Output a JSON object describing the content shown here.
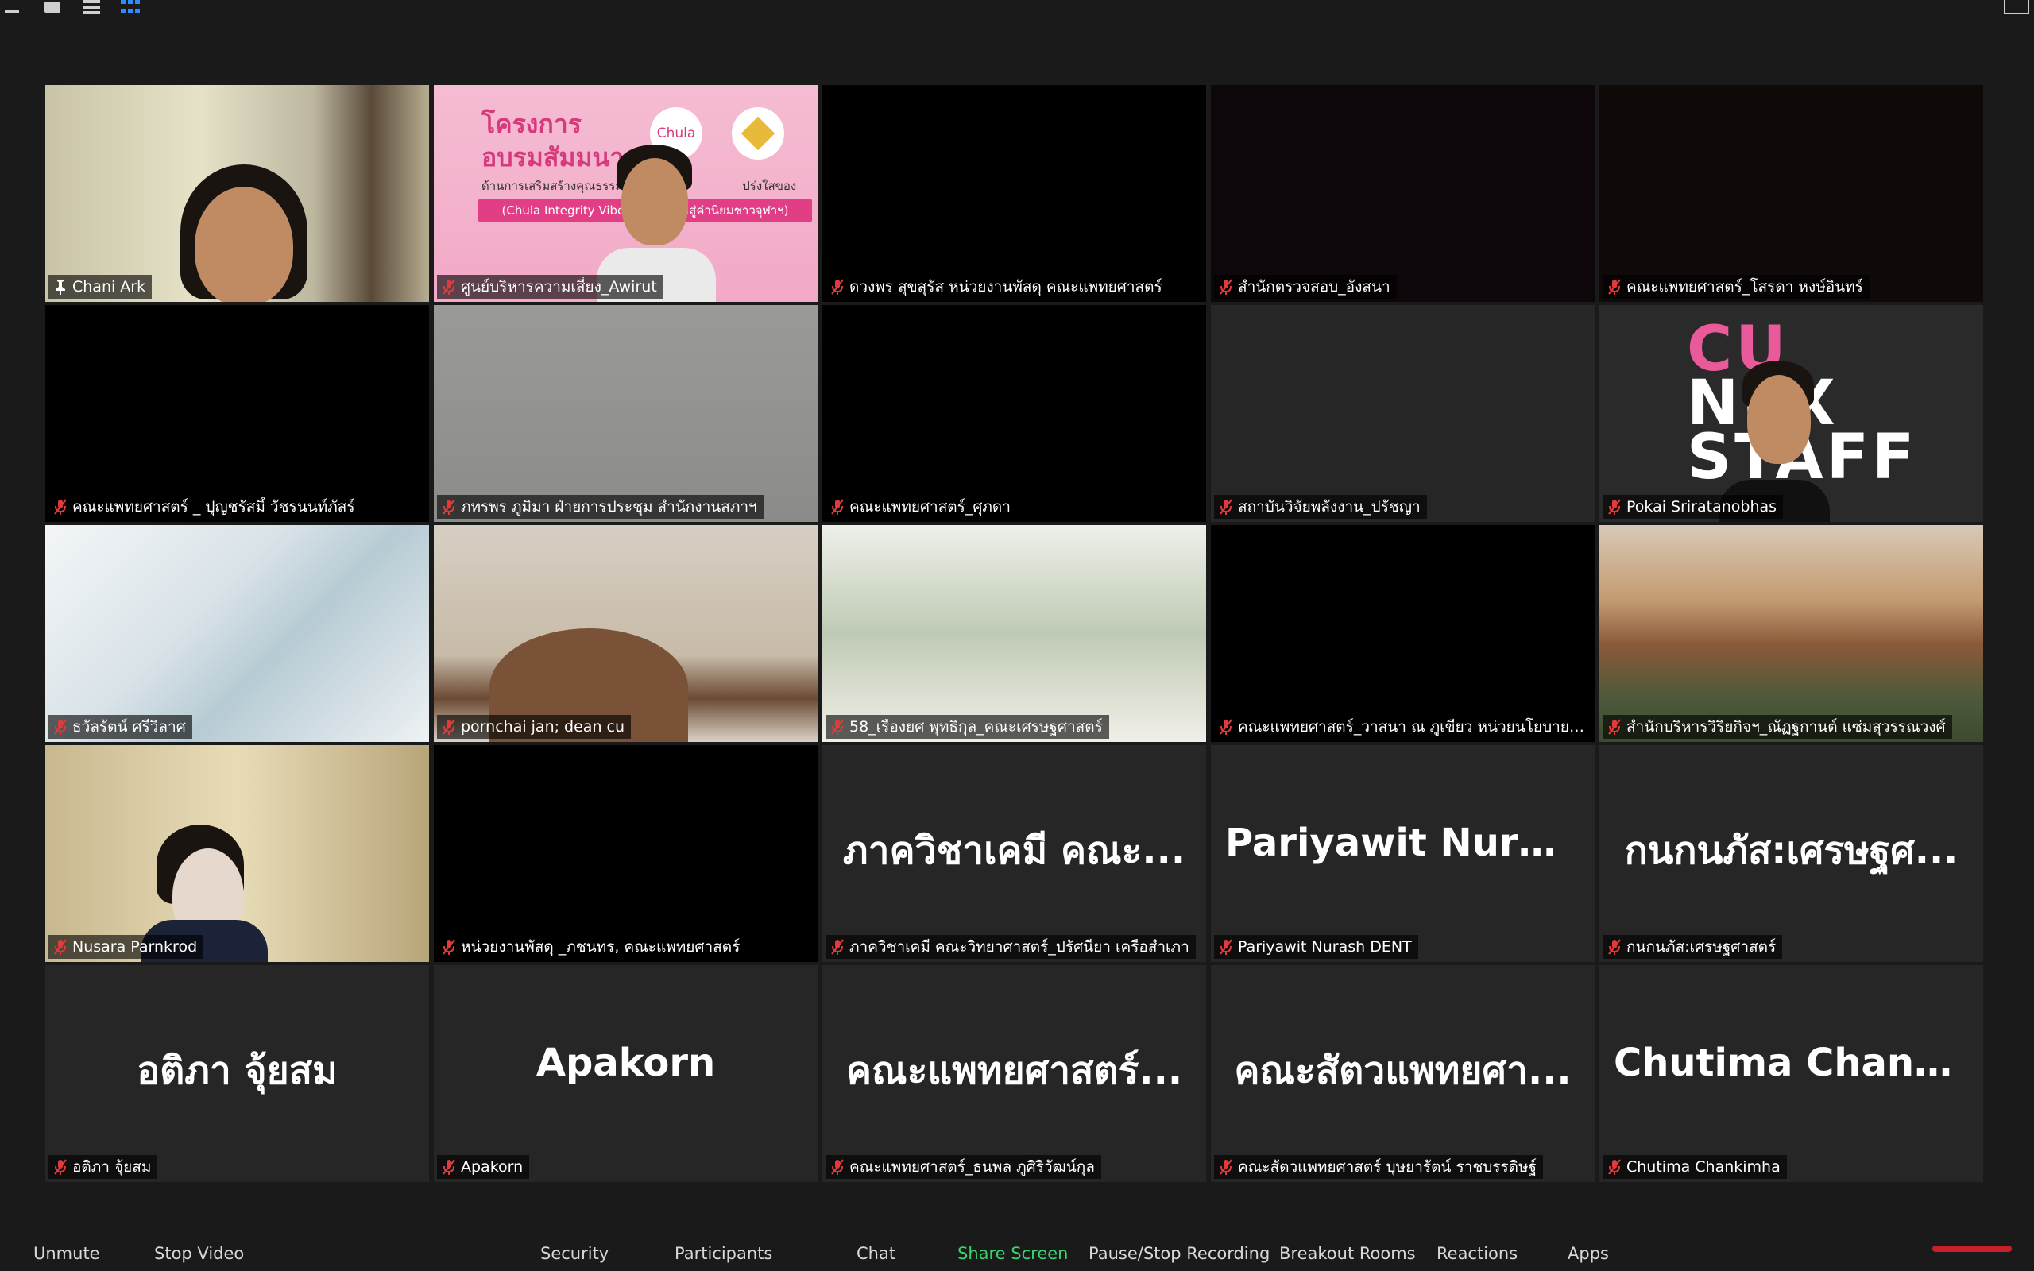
{
  "tiles": [
    {
      "name": "Chani Ark",
      "big": "",
      "muted": false,
      "pinned": true,
      "bg": "person1",
      "active": true
    },
    {
      "name": "ศูนย์บริหารความเสี่ยง_Awirut",
      "big": "",
      "muted": true,
      "bg": "slide"
    },
    {
      "name": "ดวงพร  สุขสุรัส หน่วยงานพัสดุ คณะแพทยศาสตร์",
      "big": "",
      "muted": true,
      "bg": "dark"
    },
    {
      "name": "สำนักตรวจสอบ_อังสนา",
      "big": "",
      "muted": true,
      "bg": "darkplum"
    },
    {
      "name": "คณะแพทยศาสตร์_โสรดา หงษ์อินทร์",
      "big": "",
      "muted": true,
      "bg": "darkbrown"
    },
    {
      "name": "คณะแพทยศาสตร์ _ ปุญชรัสมิ์ วัชรนนท์ภัสร์",
      "big": "",
      "muted": true,
      "bg": "dark"
    },
    {
      "name": "ภทรพร ภูมิมา ฝ่ายการประชุม สำนักงานสภาฯ",
      "big": "",
      "muted": true,
      "bg": "wall"
    },
    {
      "name": "คณะแพทยศาสตร์_ศุภดา",
      "big": "",
      "muted": true,
      "bg": "dark"
    },
    {
      "name": "สถาบันวิจัยพลังงาน_ปรัชญา",
      "big": "",
      "muted": true,
      "bg": "plain"
    },
    {
      "name": "Pokai Sriratanobhas",
      "big": "",
      "muted": true,
      "bg": "cu"
    },
    {
      "name": "ธวัลรัตน์ ศรีวิลาศ",
      "big": "",
      "muted": true,
      "bg": "library"
    },
    {
      "name": "pornchai jan; dean cu",
      "big": "",
      "muted": true,
      "bg": "room"
    },
    {
      "name": "58_เรืองยศ พุทธิกุล_คณะเศรษฐศาสตร์",
      "big": "",
      "muted": true,
      "bg": "window"
    },
    {
      "name": "คณะแพทยศาสตร์_วาสนา ณ ภูเขียว หน่วยนโยบายและแผน",
      "big": "",
      "muted": true,
      "bg": "dark"
    },
    {
      "name": "สำนักบริหารวิริยกิจฯ_ณัฏฐกานต์ แซ่มสุวรรณวงศ์",
      "big": "",
      "muted": true,
      "bg": "campus"
    },
    {
      "name": "Nusara Parnkrod",
      "big": "",
      "muted": true,
      "bg": "hall"
    },
    {
      "name": "หน่วยงานพัสดุ _ภชนทร, คณะแพทยศาสตร์",
      "big": "",
      "muted": true,
      "bg": "dark"
    },
    {
      "name": "ภาควิชาเคมี คณะวิทยาศาสตร์_ปรัศนียา เครือสำเภา",
      "big": "ภาควิชาเคมี คณะ...",
      "muted": true,
      "bg": "plain"
    },
    {
      "name": "Pariyawit Nurash DENT",
      "big": "Pariyawit  Nuras...",
      "muted": true,
      "bg": "plain"
    },
    {
      "name": "กนกนภัส:เศรษฐศาสตร์",
      "big": "กนกนภัส:เศรษฐศ...",
      "muted": true,
      "bg": "plain"
    },
    {
      "name": "อติภา  จุ้ยสม",
      "big": "อติภา  จุ้ยสม",
      "muted": true,
      "bg": "plain"
    },
    {
      "name": "Apakorn",
      "big": "Apakorn",
      "muted": true,
      "bg": "plain"
    },
    {
      "name": "คณะแพทยศาสตร์_ธนพล ภูศิริวัฒน์กุล",
      "big": "คณะแพทยศาสตร์...",
      "muted": true,
      "bg": "plain"
    },
    {
      "name": "คณะสัตวแพทยศาสตร์ บุษยารัตน์ ราชบรรดิษฐ์",
      "big": "คณะสัตวแพทยศา...",
      "muted": true,
      "bg": "plain"
    },
    {
      "name": "Chutima Chankimha",
      "big": "Chutima  Chanki...",
      "muted": true,
      "bg": "plain"
    }
  ],
  "slide": {
    "title_line1": "โครงการ",
    "title_line2": "อบรมสัมมนา",
    "subtitle": "ด้านการเสริมสร้างคุณธรรม",
    "subtitle2": "ปร่งใสของมหาวิทยาลัย",
    "strip": "(Chula Integrity Vibes: ส            ุณธรรมสู่ค่านิยมชาวจุฬาฯ)",
    "logo_text": "Chula"
  },
  "cu_slide": {
    "line1": "CU",
    "line2": "NEX",
    "line3": "STAFF"
  },
  "toolbar": {
    "unmute": "Unmute",
    "stop_video": "Stop Video",
    "security": "Security",
    "participants": "Participants",
    "chat": "Chat",
    "share_screen": "Share Screen",
    "recording": "Pause/Stop Recording",
    "breakout": "Breakout Rooms",
    "reactions": "Reactions",
    "apps": "Apps"
  },
  "colors": {
    "accent_green": "#3bd16f",
    "active_border": "#c8e35a",
    "mute_red": "#e03b3b",
    "grid_icon": "#2d8cff"
  }
}
